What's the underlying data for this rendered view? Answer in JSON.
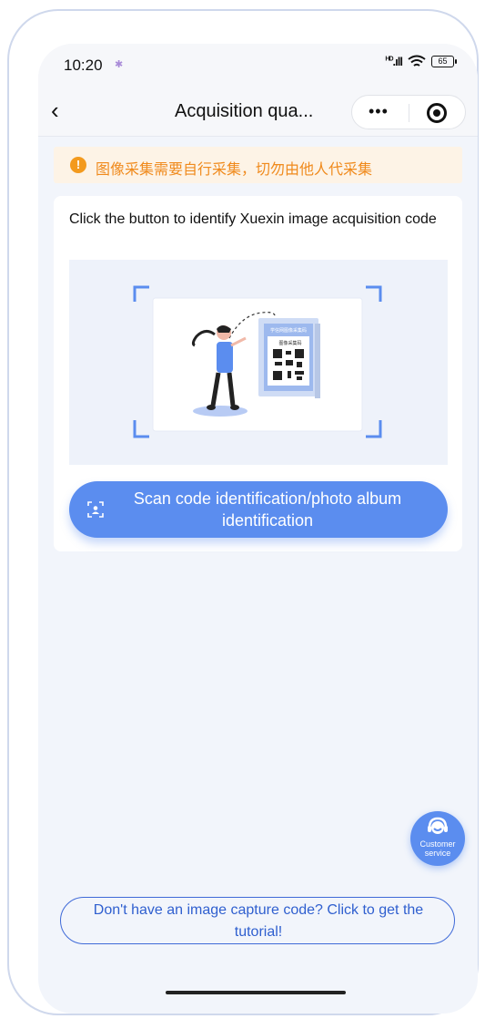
{
  "status_bar": {
    "time": "10:20",
    "network": "HD",
    "battery": "65"
  },
  "navbar": {
    "title": "Acquisition qua...",
    "more_icon": "more-dots-icon",
    "close_icon": "target-circle-icon"
  },
  "notice": {
    "icon": "exclamation-icon",
    "text": "图像采集需要自行采集，切勿由他人代采集"
  },
  "card": {
    "title": "Click the button to identify Xuexin image acquisition code",
    "illustration_sign": "学信网图像采集码",
    "illustration_sub": "图像采集码",
    "scan_button": "Scan code identification/photo album identification"
  },
  "customer_service": {
    "label": "Customer service"
  },
  "tutorial_link": "Don't have an image capture code? Click to get the tutorial!",
  "colors": {
    "primary": "#5b8def",
    "warning": "#f08a1c",
    "warning_bg": "#fdf3e6",
    "link": "#2f5fcf"
  }
}
